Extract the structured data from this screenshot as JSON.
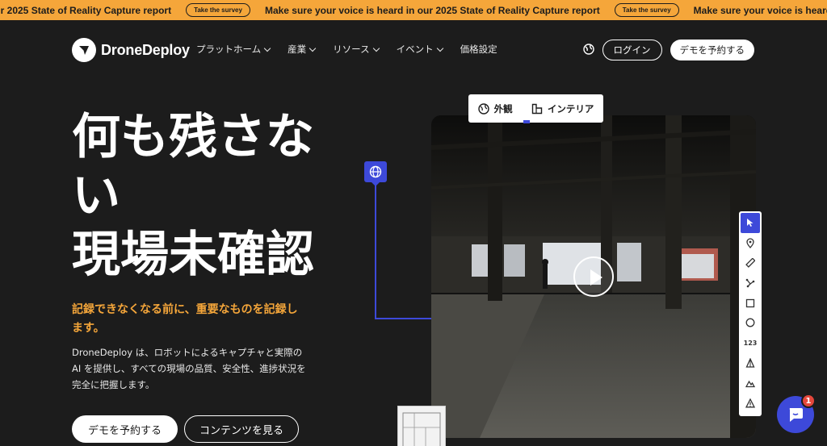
{
  "banner": {
    "message": "Make sure your voice is heard in our 2025 State of Reality Capture report",
    "partial_message": "in our 2025 State of Reality Capture report",
    "button_label": "Take the survey"
  },
  "nav": {
    "logo_text": "DroneDeploy",
    "links": [
      "プラットホーム",
      "産業",
      "リソース",
      "イベント",
      "価格設定"
    ],
    "login_label": "ログイン",
    "demo_label": "デモを予約する"
  },
  "hero": {
    "title_line1": "何も残さな",
    "title_line2": "い",
    "title_line3": "現場未確認",
    "subtitle": "記録できなくなる前に、重要なものを記録します。",
    "description": "DroneDeploy は、ロボットによるキャプチャと実際の AI を提供し、すべての現場の品質、安全性、進捗状況を完全に把握します。",
    "cta_primary": "デモを予約する",
    "cta_secondary": "コンテンツを見る"
  },
  "viewer": {
    "toggle_exterior": "外観",
    "toggle_interior": "インテリア",
    "tools": [
      "pointer-icon",
      "location-pin-icon",
      "ruler-icon",
      "polyline-icon",
      "rectangle-icon",
      "circle-icon",
      "123",
      "cone-icon",
      "terrain-icon",
      "warning-icon"
    ]
  },
  "chat": {
    "badge_count": "1"
  },
  "colors": {
    "accent": "#f5a63a",
    "brand_blue": "#3d49d9",
    "background": "#1c1c1c"
  }
}
